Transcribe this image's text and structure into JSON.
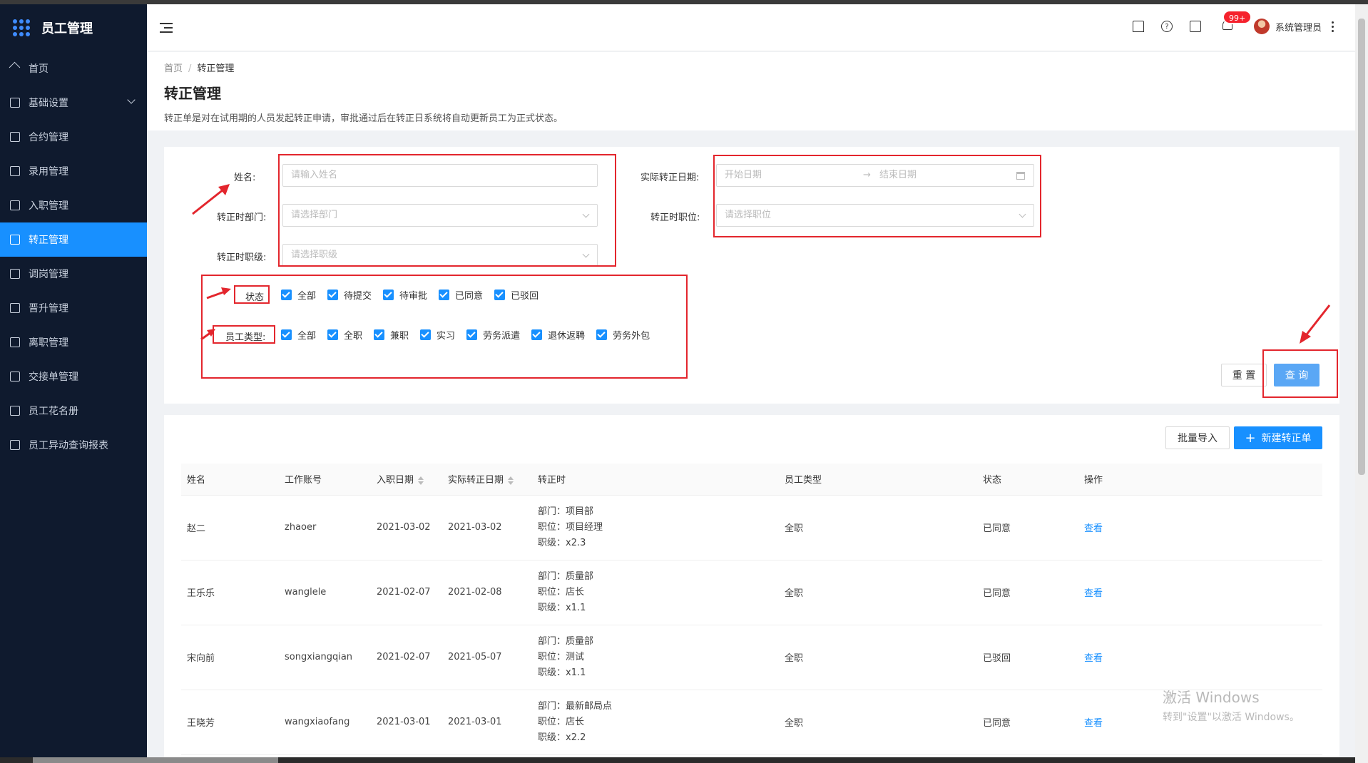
{
  "app": {
    "title": "员工管理"
  },
  "sidebar": {
    "items": [
      {
        "label": "首页",
        "icon": "home-icon"
      },
      {
        "label": "基础设置",
        "icon": "mail-icon",
        "expandable": true
      },
      {
        "label": "合约管理",
        "icon": "calendar-icon"
      },
      {
        "label": "录用管理",
        "icon": "book-icon"
      },
      {
        "label": "入职管理",
        "icon": "file-icon"
      },
      {
        "label": "转正管理",
        "icon": "grid-icon",
        "active": true
      },
      {
        "label": "调岗管理",
        "icon": "user-icon"
      },
      {
        "label": "晋升管理",
        "icon": "list-icon"
      },
      {
        "label": "离职管理",
        "icon": "user-leave-icon"
      },
      {
        "label": "交接单管理",
        "icon": "copy-icon"
      },
      {
        "label": "员工花名册",
        "icon": "roster-icon"
      },
      {
        "label": "员工异动查询报表",
        "icon": "report-icon"
      }
    ]
  },
  "header": {
    "badge": "99+",
    "username": "系统管理员"
  },
  "page": {
    "breadcrumb": [
      "首页",
      "转正管理"
    ],
    "title": "转正管理",
    "description": "转正单是对在试用期的人员发起转正申请，审批通过后在转正日系统将自动更新员工为正式状态。"
  },
  "filters": {
    "name_label": "姓名:",
    "name_placeholder": "请输入姓名",
    "dept_label": "转正时部门:",
    "dept_placeholder": "请选择部门",
    "level_label": "转正时职级:",
    "level_placeholder": "请选择职级",
    "date_label": "实际转正日期:",
    "date_start_placeholder": "开始日期",
    "date_sep": "→",
    "date_end_placeholder": "结束日期",
    "position_label": "转正时职位:",
    "position_placeholder": "请选择职位",
    "status_label": "状态",
    "status_options": [
      "全部",
      "待提交",
      "待审批",
      "已同意",
      "已驳回"
    ],
    "type_label": "员工类型:",
    "type_options": [
      "全部",
      "全职",
      "兼职",
      "实习",
      "劳务派遣",
      "退休返聘",
      "劳务外包"
    ],
    "reset_label": "重 置",
    "query_label": "查 询"
  },
  "toolbar": {
    "import_label": "批量导入",
    "new_label": "新建转正单",
    "plus": "+"
  },
  "table": {
    "headers": [
      "姓名",
      "工作账号",
      "入职日期",
      "实际转正日期",
      "转正时",
      "员工类型",
      "状态",
      "操作"
    ],
    "rows": [
      {
        "name": "赵二",
        "account": "zhaoer",
        "join": "2021-03-02",
        "regular": "2021-03-02",
        "dept": "部门：项目部",
        "position": "职位：项目经理",
        "level": "职级：x2.3",
        "type": "全职",
        "status": "已同意",
        "action": "查看"
      },
      {
        "name": "王乐乐",
        "account": "wanglele",
        "join": "2021-02-07",
        "regular": "2021-02-08",
        "dept": "部门：质量部",
        "position": "职位：店长",
        "level": "职级：x1.1",
        "type": "全职",
        "status": "已同意",
        "action": "查看"
      },
      {
        "name": "宋向前",
        "account": "songxiangqian",
        "join": "2021-02-07",
        "regular": "2021-05-07",
        "dept": "部门：质量部",
        "position": "职位：测试",
        "level": "职级：x1.1",
        "type": "全职",
        "status": "已驳回",
        "action": "查看"
      },
      {
        "name": "王晓芳",
        "account": "wangxiaofang",
        "join": "2021-03-01",
        "regular": "2021-03-01",
        "dept": "部门：最新邮局点",
        "position": "职位：店长",
        "level": "职级：x2.2",
        "type": "全职",
        "status": "已同意",
        "action": "查看"
      }
    ]
  },
  "watermark": {
    "line1": "激活 Windows",
    "line2": "转到\"设置\"以激活 Windows。"
  },
  "colors": {
    "accent": "#1890ff",
    "sidebar_bg": "#0f1a2e",
    "annotation": "#e3262d"
  }
}
